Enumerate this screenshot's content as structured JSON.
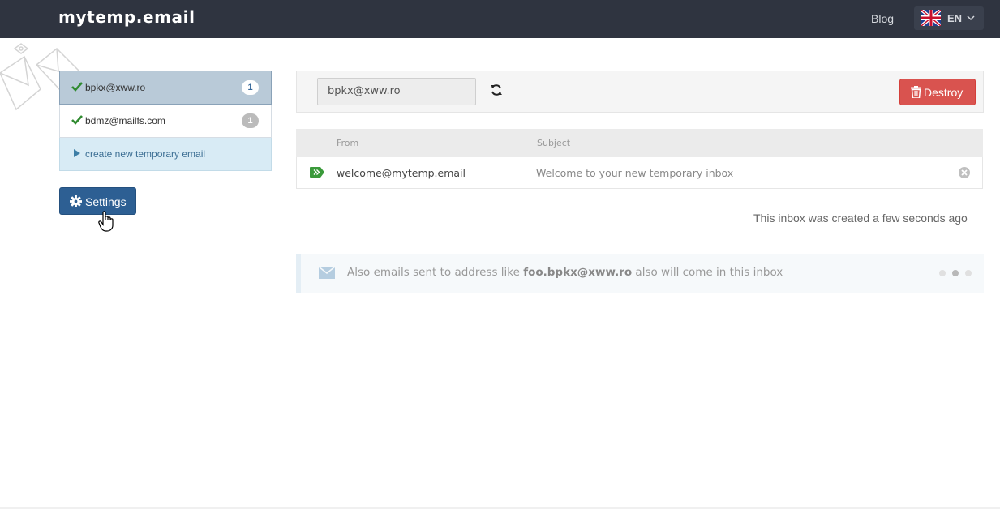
{
  "navbar": {
    "brand": "mytemp.email",
    "blog": "Blog",
    "language": {
      "code": "EN",
      "flag": "uk-flag-icon"
    }
  },
  "addresses": [
    {
      "address": "bpkx@xww.ro",
      "count": "1",
      "active": true
    },
    {
      "address": "bdmz@mailfs.com",
      "count": "1",
      "active": false
    }
  ],
  "create_label": "create new temporary email",
  "settings_label": "Settings",
  "toolbar": {
    "current_address": "bpkx@xww.ro",
    "destroy_label": "Destroy"
  },
  "table": {
    "headers": {
      "from": "From",
      "subject": "Subject"
    },
    "rows": [
      {
        "from": "welcome@mytemp.email",
        "subject": "Welcome to your new temporary inbox"
      }
    ]
  },
  "created_text": "This inbox was created a few seconds ago",
  "alert": {
    "prefix": "Also emails sent to address like ",
    "highlight": "foo.bpkx@xww.ro",
    "suffix": " also will come in this inbox"
  },
  "colors": {
    "navbar": "#2f3440",
    "primary": "#2d5f93",
    "danger": "#d9534f",
    "success": "#3a9a3a",
    "active_row": "#b9cad8",
    "create_row": "#d8ebf5"
  }
}
